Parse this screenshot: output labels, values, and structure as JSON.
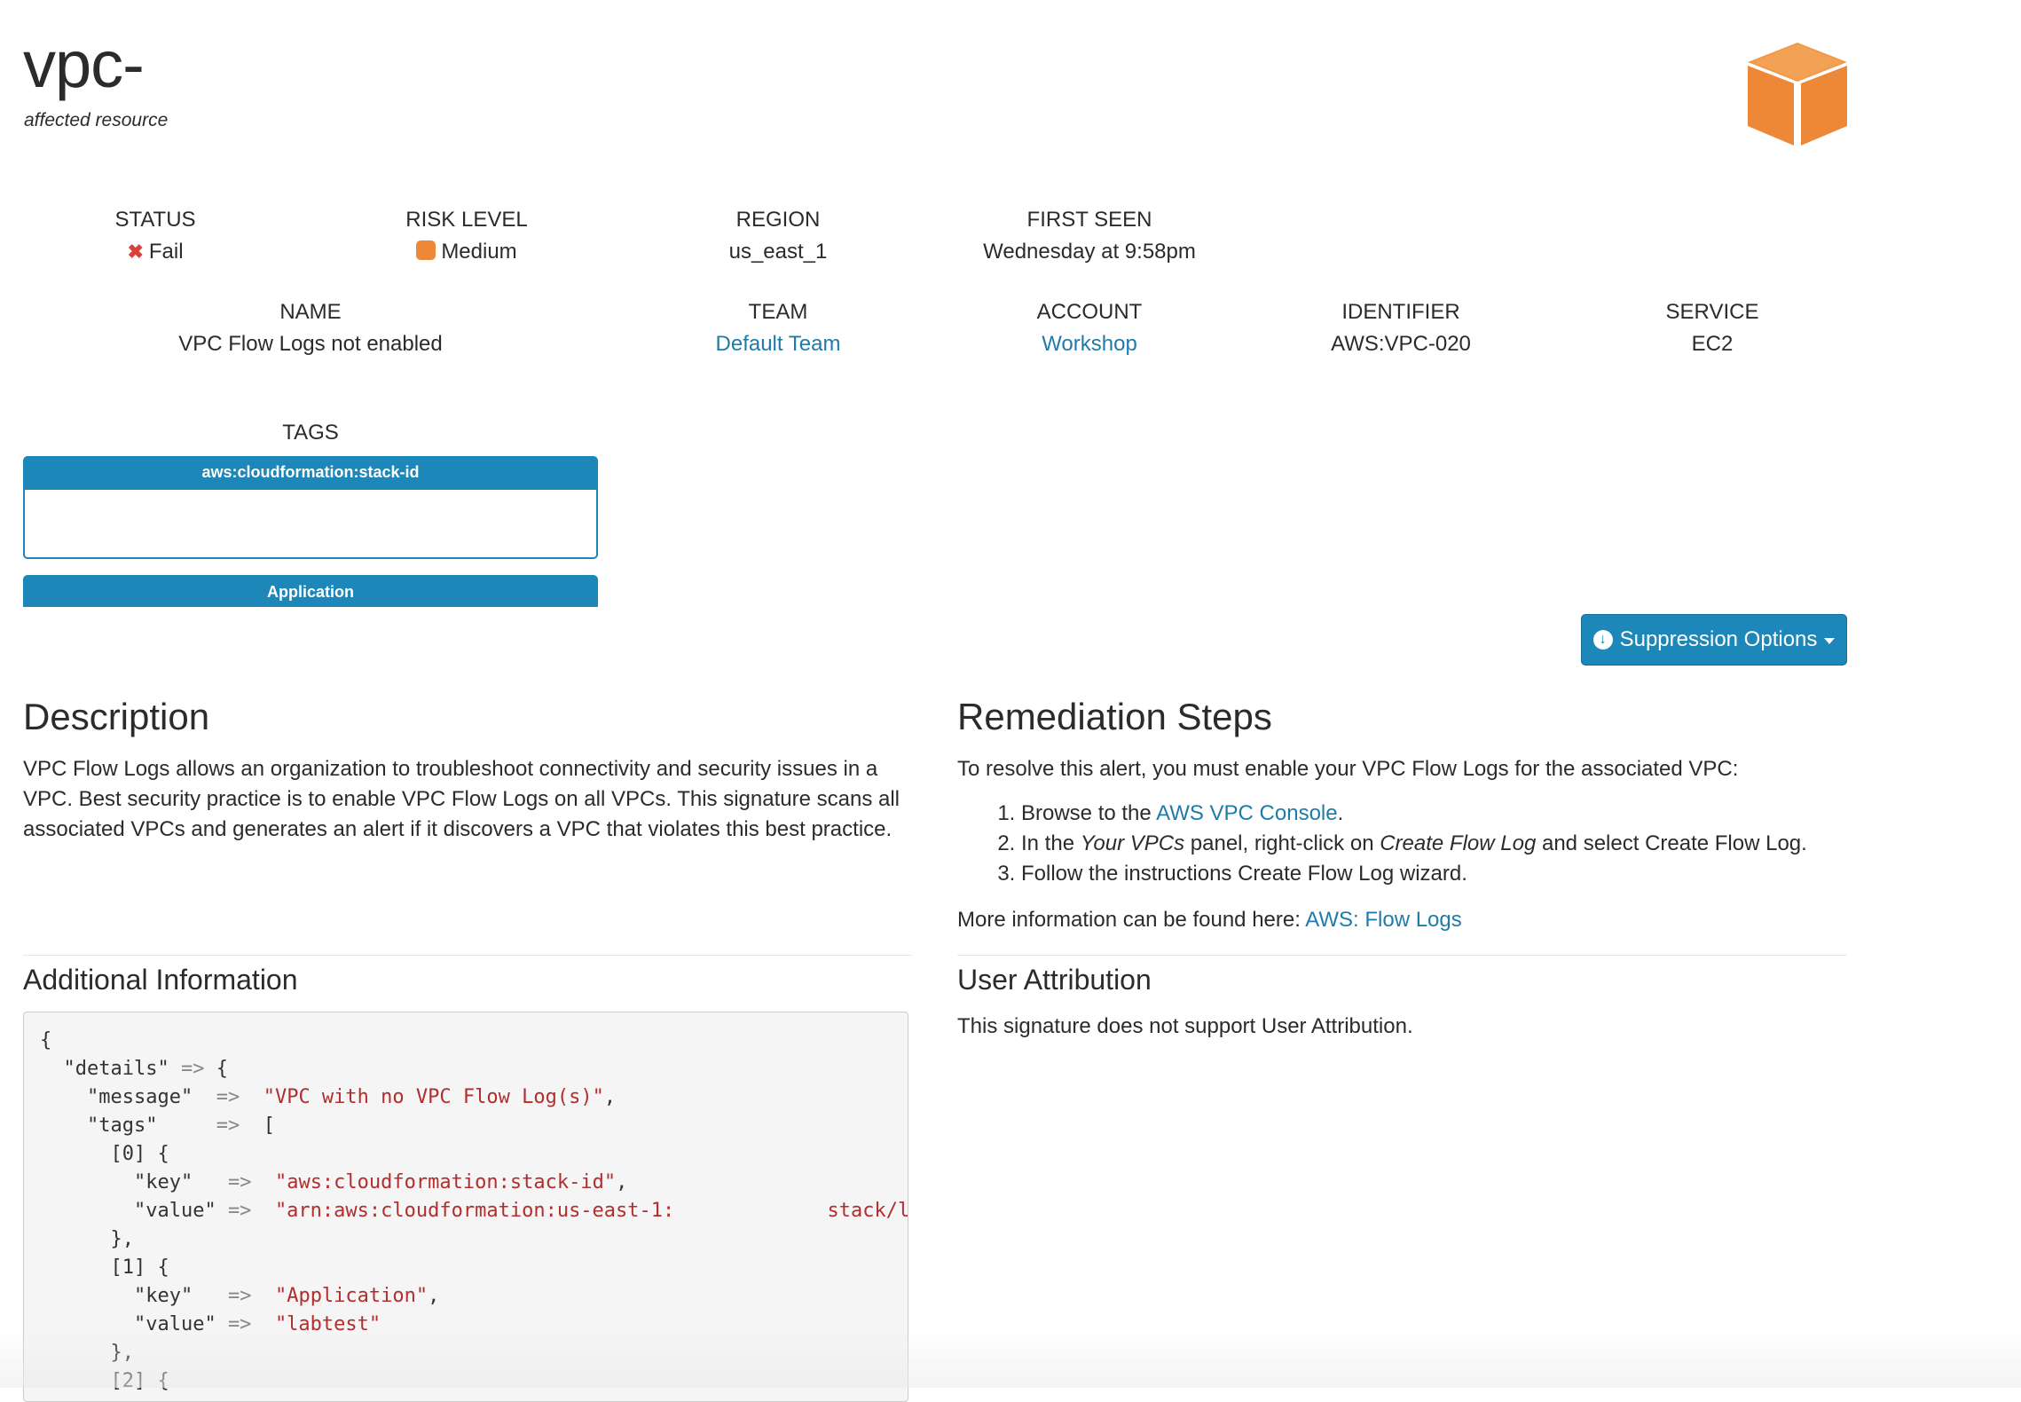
{
  "header": {
    "title": "vpc-",
    "subtitle": "affected resource",
    "logo_icon": "aws-box-icon",
    "logo_color": "#ec8837"
  },
  "fields": {
    "status": {
      "label": "STATUS",
      "value": "Fail",
      "icon": "x-icon",
      "color": "#d9413a"
    },
    "risk": {
      "label": "RISK LEVEL",
      "value": "Medium",
      "icon": "square-icon",
      "color": "#ec8837"
    },
    "region": {
      "label": "REGION",
      "value": "us_east_1"
    },
    "first_seen": {
      "label": "FIRST SEEN",
      "value": "Wednesday at 9:58pm"
    },
    "name": {
      "label": "NAME",
      "value": "VPC Flow Logs not enabled"
    },
    "team": {
      "label": "TEAM",
      "value": "Default Team"
    },
    "account": {
      "label": "ACCOUNT",
      "value": "Workshop"
    },
    "identifier": {
      "label": "IDENTIFIER",
      "value": "AWS:VPC-020"
    },
    "service": {
      "label": "SERVICE",
      "value": "EC2"
    }
  },
  "tags": {
    "label": "TAGS",
    "items": [
      {
        "key": "aws:cloudformation:stack-id",
        "value": ""
      },
      {
        "key": "Application",
        "value": ""
      }
    ]
  },
  "suppression": {
    "label": "Suppression Options",
    "icon": "download-circle-icon",
    "color": "#1c87b8"
  },
  "description": {
    "heading": "Description",
    "text": "VPC Flow Logs allows an organization to troubleshoot connectivity and security issues in a VPC. Best security practice is to enable VPC Flow Logs on all VPCs. This signature scans all associated VPCs and generates an alert if it discovers a VPC that violates this best practice."
  },
  "remediation": {
    "heading": "Remediation Steps",
    "intro": "To resolve this alert, you must enable your VPC Flow Logs for the associated VPC:",
    "step1_prefix": "Browse to the ",
    "step1_link": "AWS VPC Console",
    "step1_suffix": ".",
    "step2_a": "In the ",
    "step2_b": "Your VPCs",
    "step2_c": " panel, right-click on ",
    "step2_d": "Create Flow Log",
    "step2_e": " and select ",
    "step2_f": "Create Flow Log",
    "step2_g": ".",
    "step3": "Follow the instructions Create Flow Log wizard.",
    "more_prefix": "More information can be found here: ",
    "more_link": "AWS: Flow Logs"
  },
  "additional": {
    "heading": "Additional Information",
    "details_key": "\"details\"",
    "message_key": "\"message\"",
    "message_val": "\"VPC with no VPC Flow Log(s)\"",
    "tags_key": "\"tags\"",
    "idx0": "[0]",
    "idx1": "[1]",
    "idx2": "[2]",
    "key_key": "\"key\"",
    "value_key": "\"value\"",
    "tag0_key": "\"aws:cloudformation:stack-id\"",
    "tag0_value_a": "\"arn:aws:cloudformation:us-east-1:",
    "tag0_value_b": "stack/la",
    "tag1_key": "\"Application\"",
    "tag1_value": "\"labtest\"",
    "arrow": "=>"
  },
  "attribution": {
    "heading": "User Attribution",
    "text": "This signature does not support User Attribution."
  }
}
